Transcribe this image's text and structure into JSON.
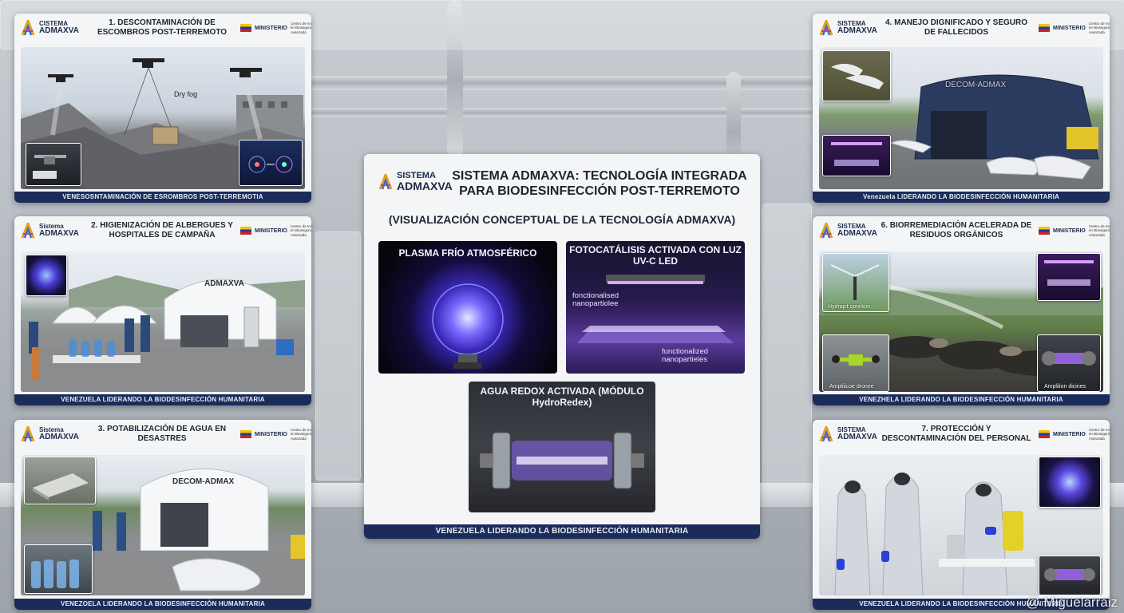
{
  "logo": {
    "line1": "SISTEMA",
    "line2": "ADMAXVA"
  },
  "ministry": {
    "label": "MINISTERIO",
    "text": "Centro de Innovación en Bioseguridad Avanzada"
  },
  "footer": "VENEZUELA LIDERANDO LA BIODESINFECCIÓN HUMANITARIA",
  "panels": {
    "p1": {
      "logo_line1": "CISTEMA",
      "logo_line2": "ADMAXVA",
      "title": "1. DESCONTAMINACIÓN DE ESCOMBROS POST-TERREMOTO",
      "ministry_label": "MINISTERIO",
      "label": "Dry fog",
      "footer": "VENESOSNTAMINACIÓN DE ESROMBROS POST-TERREMOTIA"
    },
    "p2": {
      "logo_line1": "Sistema",
      "logo_line2": "ADMAXVA",
      "title": "2. HIGIENIZACIÓN DE ALBERGUES Y HOSPITALES DE CAMPAÑA",
      "ministry_label": "MINISTERIO",
      "tent": "ADMAXVA",
      "footer": "VENEZUELA LIDERANDO LA BIODESINFECCIÓN HUMANITARIA"
    },
    "p3": {
      "logo_line1": "Sistema",
      "logo_line2": "ADMAXVA",
      "title": "3. POTABILIZACIÓN DE AGUA EN DESASTRES",
      "ministry_label": "MINISTERIO",
      "tent": "DECOM-ADMAX",
      "footer": "VENEZOELA LIDERANDO LA BIODESINFECCIÓN HUMANITARIA"
    },
    "p4": {
      "logo_line1": "SISTEMA",
      "logo_line2": "ADMAXVA",
      "title": "4. MANEJO DIGNIFICADO Y SEGURO DE FALLECIDOS",
      "ministry_label": "MINISTERIO",
      "tent": "DECOM-ADMAX",
      "footer": "Venezuela LIDERANDO LA BIODESINFECCIÓN HUMANITARIA"
    },
    "p6": {
      "logo_line1": "SISTEMA",
      "logo_line2": "ADMAXVA",
      "title": "6. BIORREMEDIACIÓN ACELERADA DE RESIDUOS ORGÁNICOS",
      "ministry_label": "MINISTERIO",
      "cap1": "Hydrajct cprickler.",
      "cap2": "Ampliiicoe dronee",
      "cap3": "Amplilion dicines",
      "footer": "VENEZHELA LIDERANDO LA BIODESINFECCIÓN HUMANITARIA"
    },
    "p7": {
      "logo_line1": "SISTEMA",
      "logo_line2": "ADMAXVA",
      "title": "7. PROTECCIÓN Y DESCONTAMINACIÓN DEL PERSONAL",
      "ministry_label": "MINISTERIO",
      "footer": "VENEZUELA LIDERANDO LA BIODESINFECCIÓN HUMANITARIA"
    }
  },
  "central": {
    "logo_line1": "SISTEMA",
    "logo_line2": "ADMAXVA",
    "title": "SISTEMA ADMAXVA: TECNOLOGÍA INTEGRADA PARA BIODESINFECCIÓN POST-TERREMOTO",
    "subtitle": "(VISUALIZACIÓN CONCEPTUAL DE LA TECNOLOGÍA ADMAXVA)",
    "tile1": "PLASMA FRÍO ATMOSFÉRICO",
    "tile2": "FOTOCATÁLISIS ACTIVADA CON LUZ UV-C LED",
    "tile2_label1": "fonctionalised nanopartiolee",
    "tile2_label2": "functionalized nanopartieles",
    "tile3": "AGUA REDOX ACTIVADA (MÓDULO HydroRedex)",
    "footer": "VENEZUELA LIDERANDO LA BIODESINFECCIÓN HUMANITARIA"
  },
  "watermark": "@ Miguelarraiz"
}
